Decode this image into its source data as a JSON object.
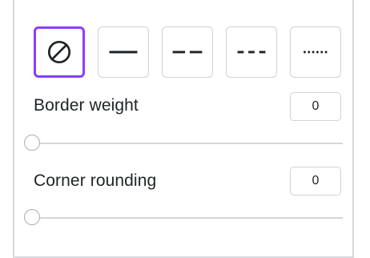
{
  "border_styles": [
    {
      "name": "none",
      "icon": "no-border-icon",
      "selected": true
    },
    {
      "name": "solid",
      "icon": "solid-line-icon",
      "selected": false
    },
    {
      "name": "long-dash",
      "icon": "long-dash-line-icon",
      "selected": false
    },
    {
      "name": "short-dash",
      "icon": "short-dash-line-icon",
      "selected": false
    },
    {
      "name": "dotted",
      "icon": "dotted-line-icon",
      "selected": false
    }
  ],
  "border_weight": {
    "label": "Border weight",
    "value": "0",
    "slider_fraction": 0
  },
  "corner_rounding": {
    "label": "Corner rounding",
    "value": "0",
    "slider_fraction": 0
  },
  "colors": {
    "accent": "#8b3dff",
    "border": "#cfd2d6",
    "text": "#1f2328"
  }
}
